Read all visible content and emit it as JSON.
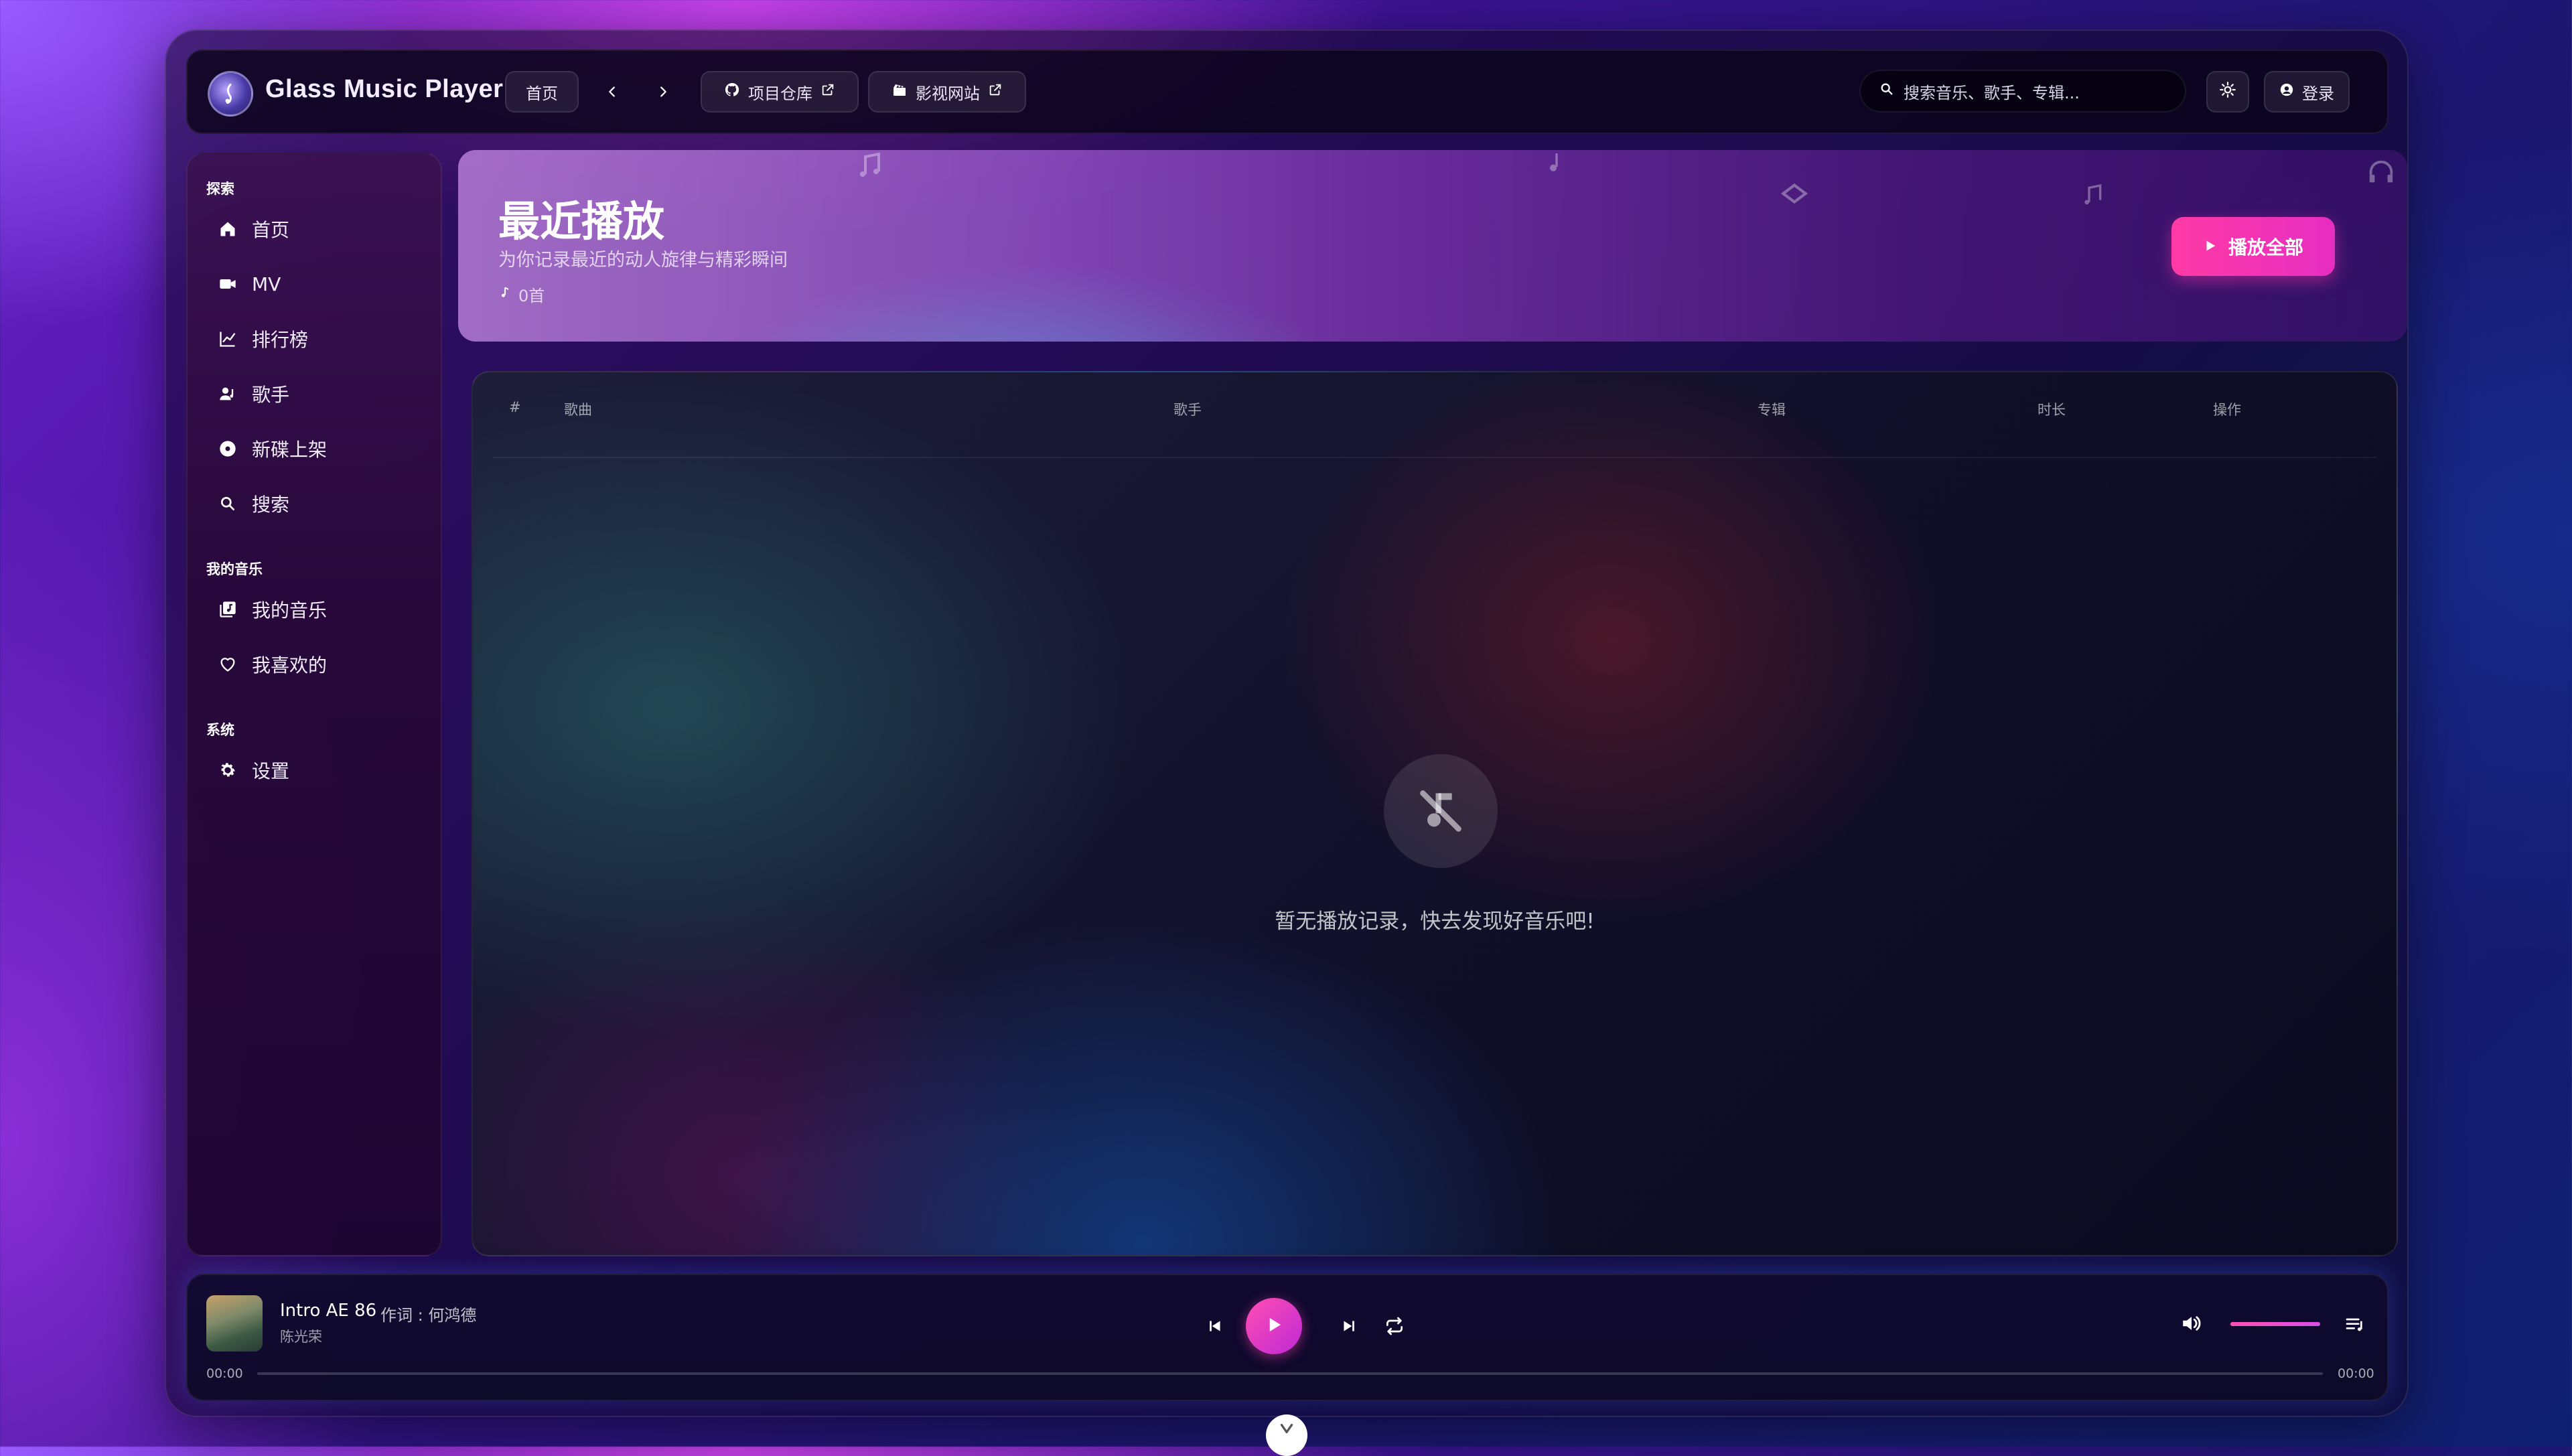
{
  "header": {
    "app_title": "Glass Music Player",
    "home_button": "首页",
    "back_icon": "chevron-left-icon",
    "forward_icon": "chevron-right-icon",
    "repo_link": "项目仓库",
    "video_link": "影视网站",
    "search_placeholder": "搜索音乐、歌手、专辑...",
    "theme_icon": "sun-icon",
    "login_button": "登录"
  },
  "sidebar": {
    "sections": [
      {
        "title": "探索",
        "items": [
          {
            "label": "首页",
            "icon": "home-icon"
          },
          {
            "label": "MV",
            "icon": "video-camera-icon"
          },
          {
            "label": "排行榜",
            "icon": "chart-line-icon"
          },
          {
            "label": "歌手",
            "icon": "user-music-icon"
          },
          {
            "label": "新碟上架",
            "icon": "disc-icon"
          },
          {
            "label": "搜索",
            "icon": "search-icon"
          }
        ]
      },
      {
        "title": "我的音乐",
        "items": [
          {
            "label": "我的音乐",
            "icon": "music-library-icon"
          },
          {
            "label": "我喜欢的",
            "icon": "heart-icon"
          }
        ]
      },
      {
        "title": "系统",
        "items": [
          {
            "label": "设置",
            "icon": "gear-icon"
          }
        ]
      }
    ]
  },
  "hero": {
    "title": "最近播放",
    "subtitle": "为你记录最近的动人旋律与精彩瞬间",
    "count": "0首",
    "play_all": "播放全部"
  },
  "table": {
    "columns": [
      "#",
      "歌曲",
      "歌手",
      "专辑",
      "时长",
      "操作"
    ],
    "rows": [],
    "empty_message": "暂无播放记录，快去发现好音乐吧!"
  },
  "player": {
    "song_title": "Intro AE 86",
    "song_extra": "作词 : 何鸿德",
    "artist": "陈光荣",
    "current_time": "00:00",
    "total_time": "00:00",
    "progress": 0,
    "volume": 1.0,
    "accent_color": "#ff3aa5"
  }
}
